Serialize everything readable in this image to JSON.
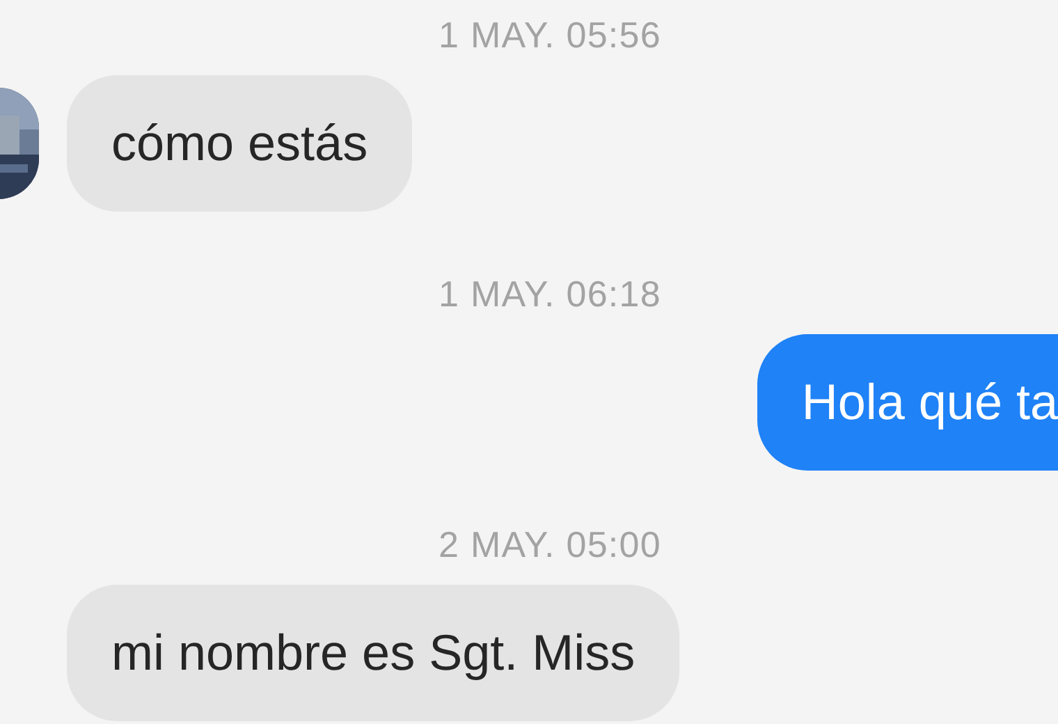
{
  "messages": [
    {
      "kind": "timestamp",
      "text": "1 MAY. 05:56"
    },
    {
      "kind": "incoming",
      "text": "cómo estás",
      "avatar": true
    },
    {
      "kind": "timestamp",
      "text": "1 MAY. 06:18"
    },
    {
      "kind": "outgoing",
      "text": "Hola qué ta"
    },
    {
      "kind": "timestamp",
      "text": "2 MAY. 05:00"
    },
    {
      "kind": "incoming",
      "text": "mi nombre es Sgt. Miss",
      "avatar": false
    }
  ]
}
